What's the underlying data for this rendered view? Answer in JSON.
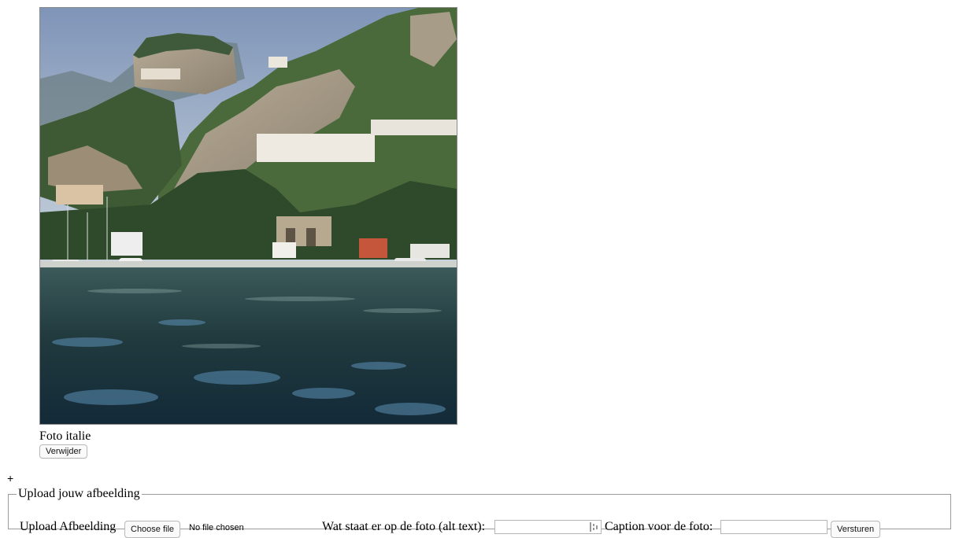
{
  "photo": {
    "caption": "Foto italie",
    "remove_label": "Verwijder"
  },
  "add_toggle": "+",
  "upload_form": {
    "legend": "Upload jouw afbeelding",
    "file_label": "Upload Afbeelding",
    "choose_file_label": "Choose file",
    "file_status": "No file chosen",
    "alt_label": "Wat staat er op de foto (alt text):",
    "alt_value": "",
    "caption_label": "Caption voor de foto:",
    "caption_value": "",
    "submit_label": "Versturen"
  }
}
